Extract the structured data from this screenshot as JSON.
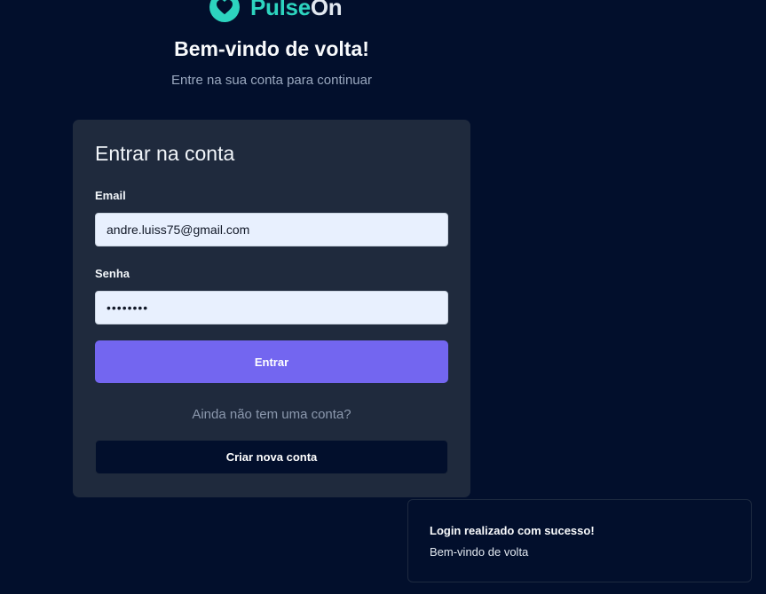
{
  "brand": {
    "name_part1": "Pulse",
    "name_part2": "On",
    "icon": "heart-icon",
    "accent_color": "#2dd4bf"
  },
  "header": {
    "title": "Bem-vindo de volta!",
    "subtitle": "Entre na sua conta para continuar"
  },
  "login_card": {
    "title": "Entrar na conta",
    "email_label": "Email",
    "email_value": "andre.luiss75@gmail.com",
    "password_label": "Senha",
    "password_value": "••••••••",
    "submit_label": "Entrar",
    "no_account_text": "Ainda não tem uma conta?",
    "create_account_label": "Criar nova conta",
    "button_color": "#7366f0"
  },
  "toast": {
    "title": "Login realizado com sucesso!",
    "description": "Bem-vindo de volta"
  }
}
